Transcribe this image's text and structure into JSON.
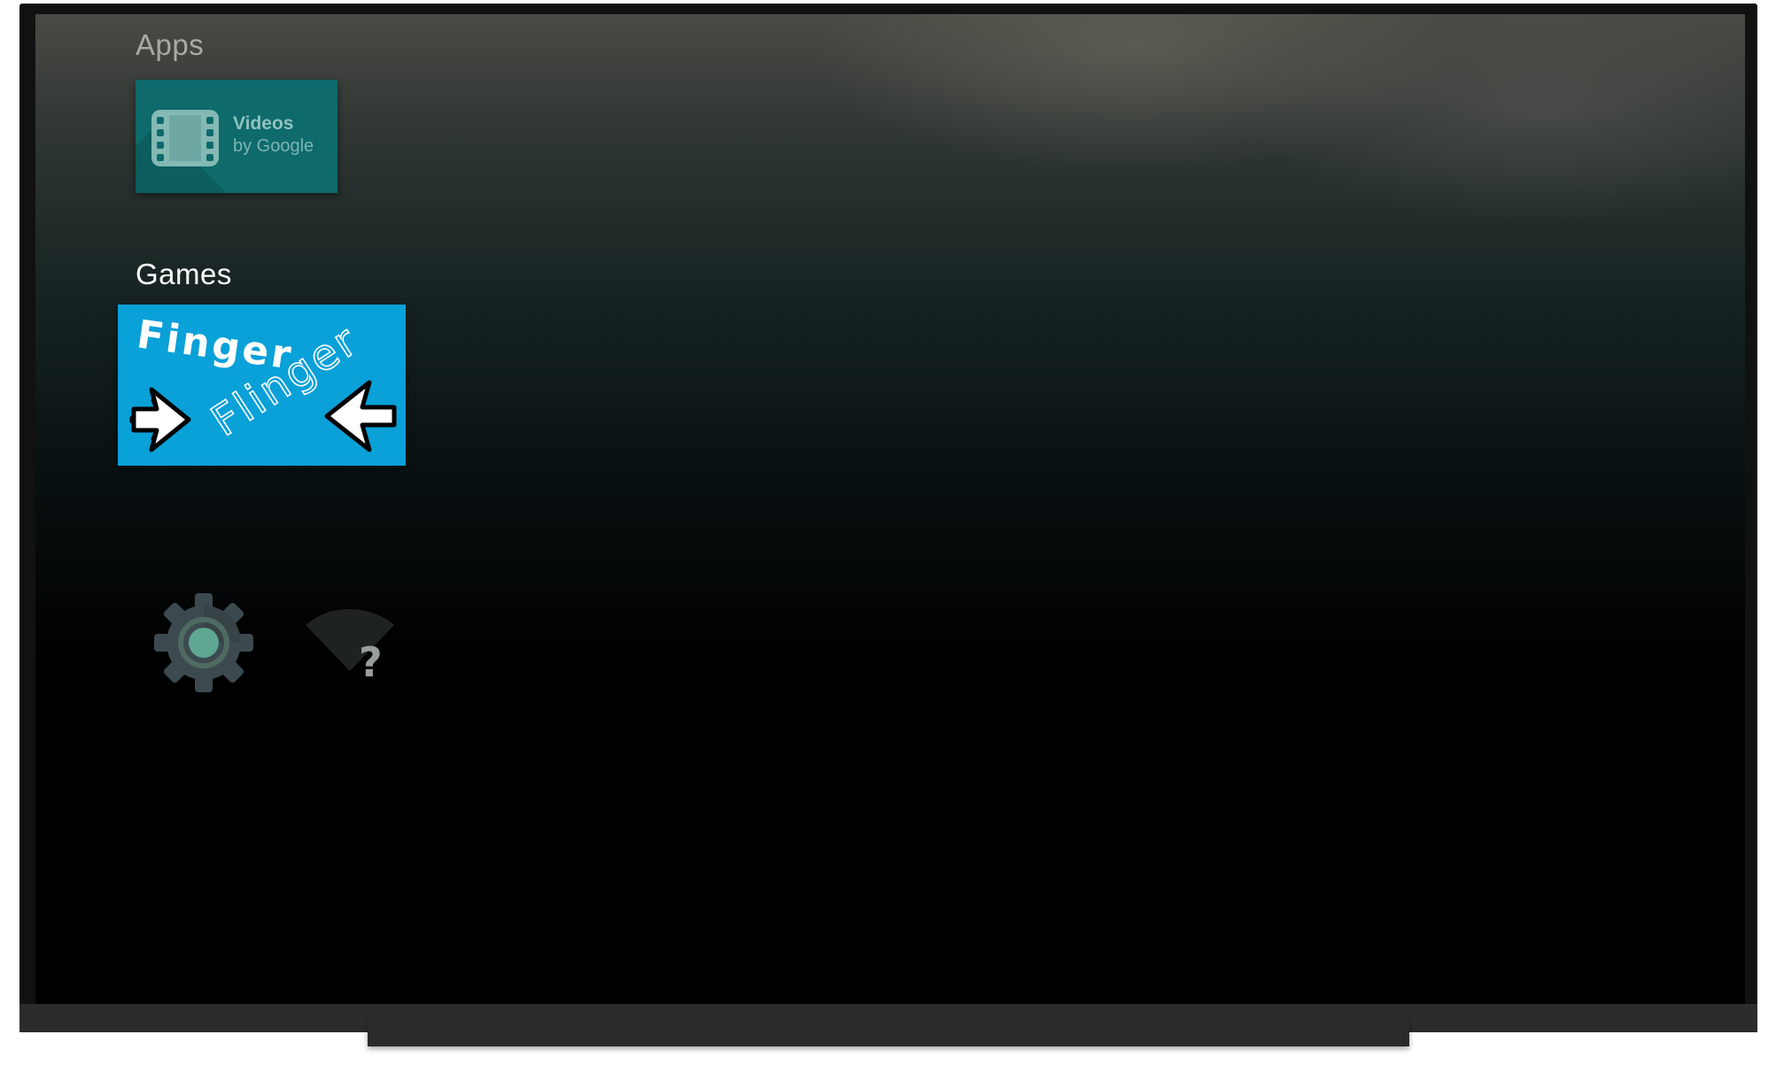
{
  "rows": {
    "apps": {
      "title": "Apps",
      "items": [
        {
          "title": "Videos",
          "subtitle": "by Google",
          "icon": "film-icon"
        }
      ]
    },
    "games": {
      "title": "Games",
      "items": [
        {
          "title_line1": "Finger",
          "title_line2": "Flinger",
          "icon": "arrows-icon"
        }
      ]
    }
  },
  "settings_row": {
    "items": [
      {
        "icon": "gear-icon"
      },
      {
        "icon": "wifi-unknown-icon",
        "glyph": "?"
      }
    ]
  },
  "colors": {
    "videos_card": "#0e6a6b",
    "game_card": "#0aa0d8",
    "gear": "#3c4a50",
    "gear_center": "#5fa792"
  }
}
